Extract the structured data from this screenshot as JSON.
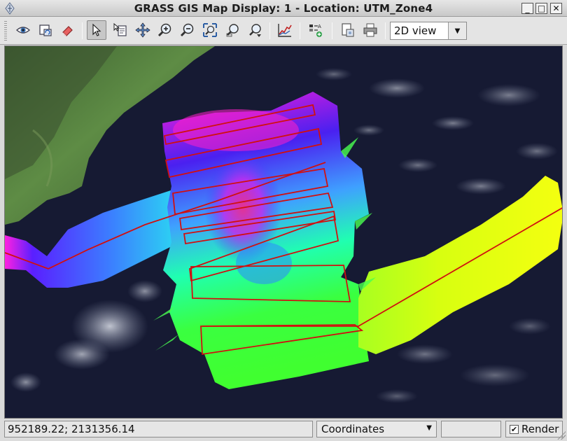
{
  "window": {
    "title": "GRASS GIS Map Display: 1  - Location: UTM_Zone4",
    "minimize_label": "_",
    "maximize_label": "□",
    "close_label": "✕"
  },
  "toolbar": {
    "items": [
      {
        "name": "display-map-button",
        "icon": "eye-icon"
      },
      {
        "name": "render-map-button",
        "icon": "render-icon"
      },
      {
        "name": "erase-display-button",
        "icon": "eraser-icon"
      },
      {
        "name": "pointer-button",
        "icon": "pointer-icon",
        "active": true
      },
      {
        "name": "query-button",
        "icon": "query-icon"
      },
      {
        "name": "pan-button",
        "icon": "pan-icon"
      },
      {
        "name": "zoom-in-button",
        "icon": "zoom-in-icon"
      },
      {
        "name": "zoom-out-button",
        "icon": "zoom-out-icon"
      },
      {
        "name": "zoom-extent-button",
        "icon": "zoom-extent-icon"
      },
      {
        "name": "zoom-back-button",
        "icon": "zoom-back-icon"
      },
      {
        "name": "zoom-menu-button",
        "icon": "zoom-menu-icon"
      },
      {
        "name": "analyze-button",
        "icon": "analyze-icon"
      },
      {
        "name": "decoration-button",
        "icon": "legend-icon"
      },
      {
        "name": "save-image-button",
        "icon": "save-image-icon"
      },
      {
        "name": "print-button",
        "icon": "print-icon"
      }
    ],
    "view_mode": {
      "selected": "2D view"
    }
  },
  "statusbar": {
    "coordinates": "952189.22; 2131356.14",
    "mode": {
      "selected": "Coordinates"
    },
    "render_checked": true,
    "render_label": "Render",
    "check_mark": "✔"
  },
  "colors": {
    "ocean": "#161a33",
    "island": "#4c7a3c",
    "track_line": "#d01010"
  }
}
